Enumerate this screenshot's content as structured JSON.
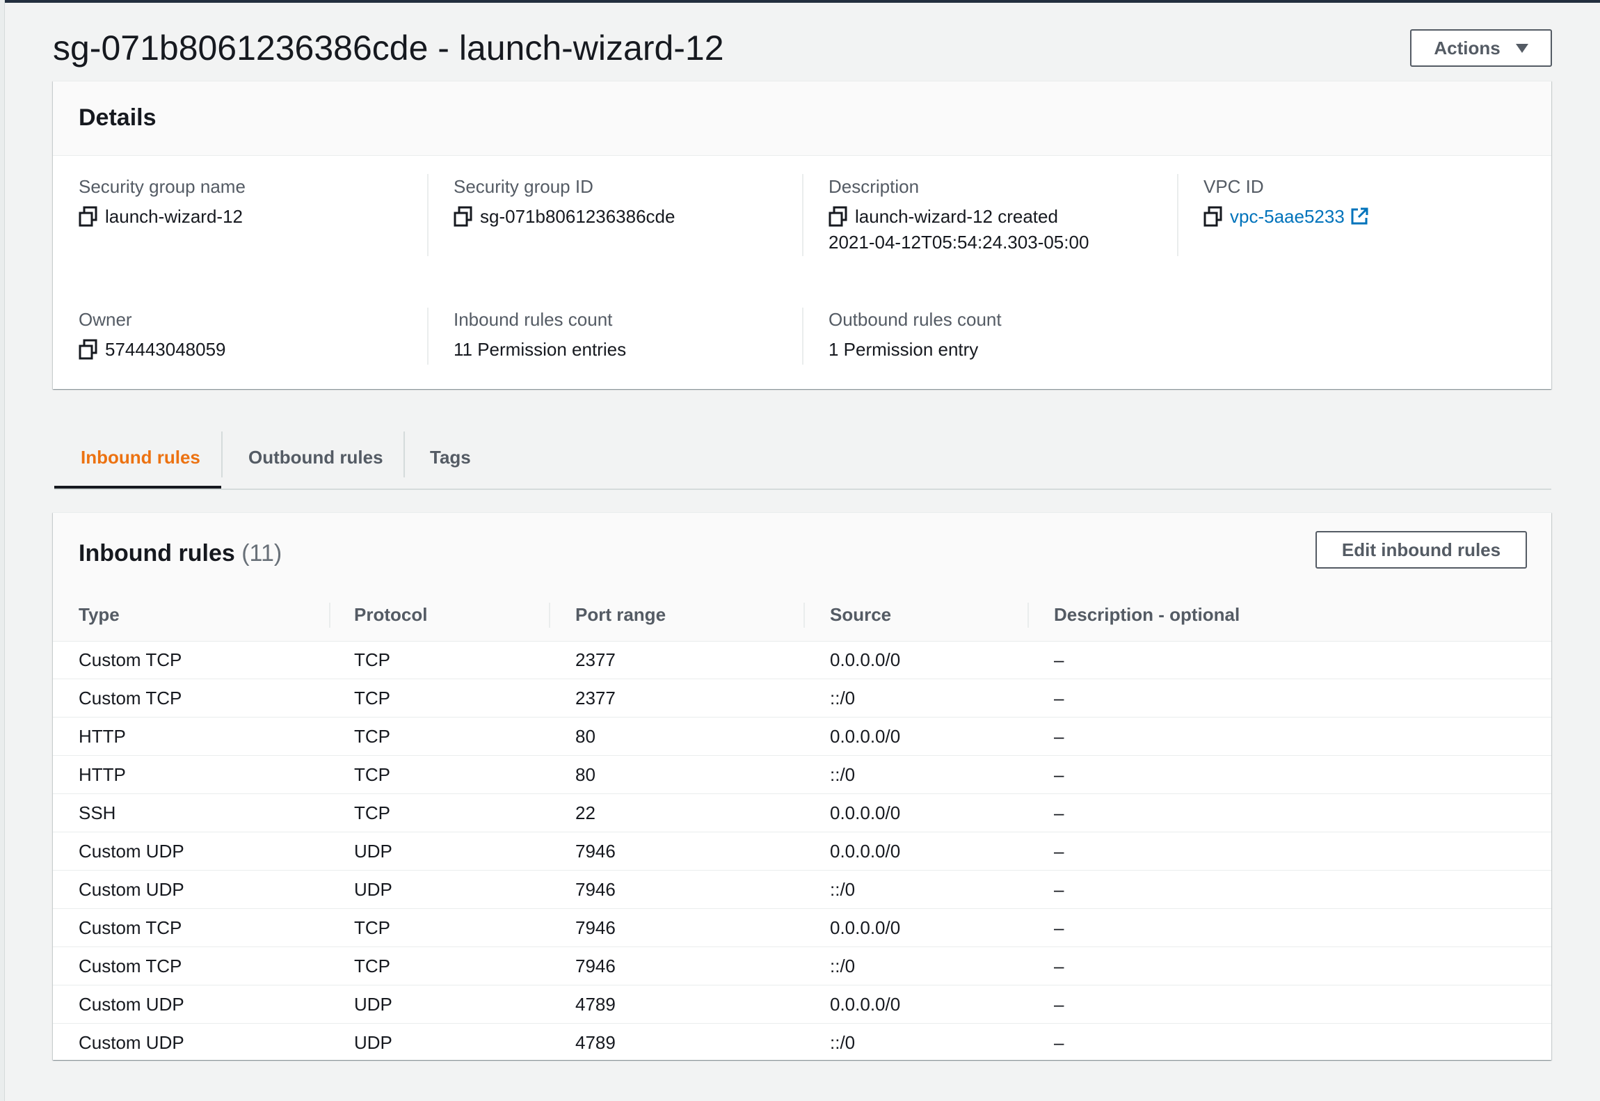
{
  "page": {
    "title": "sg-071b8061236386cde - launch-wizard-12",
    "actions_label": "Actions"
  },
  "details": {
    "heading": "Details",
    "fields": {
      "sg_name": {
        "label": "Security group name",
        "value": "launch-wizard-12"
      },
      "sg_id": {
        "label": "Security group ID",
        "value": "sg-071b8061236386cde"
      },
      "description": {
        "label": "Description",
        "value_line1": "launch-wizard-12 created",
        "value_line2": "2021-04-12T05:54:24.303-05:00"
      },
      "vpc_id": {
        "label": "VPC ID",
        "value": "vpc-5aae5233"
      },
      "owner": {
        "label": "Owner",
        "value": "574443048059"
      },
      "inbound_count": {
        "label": "Inbound rules count",
        "value": "11 Permission entries"
      },
      "outbound_count": {
        "label": "Outbound rules count",
        "value": "1 Permission entry"
      }
    }
  },
  "tabs": [
    {
      "label": "Inbound rules",
      "active": true
    },
    {
      "label": "Outbound rules",
      "active": false
    },
    {
      "label": "Tags",
      "active": false
    }
  ],
  "inbound": {
    "heading": "Inbound rules",
    "count": "(11)",
    "edit_label": "Edit inbound rules",
    "columns": [
      "Type",
      "Protocol",
      "Port range",
      "Source",
      "Description - optional"
    ],
    "rows": [
      [
        "Custom TCP",
        "TCP",
        "2377",
        "0.0.0.0/0",
        "–"
      ],
      [
        "Custom TCP",
        "TCP",
        "2377",
        "::/0",
        "–"
      ],
      [
        "HTTP",
        "TCP",
        "80",
        "0.0.0.0/0",
        "–"
      ],
      [
        "HTTP",
        "TCP",
        "80",
        "::/0",
        "–"
      ],
      [
        "SSH",
        "TCP",
        "22",
        "0.0.0.0/0",
        "–"
      ],
      [
        "Custom UDP",
        "UDP",
        "7946",
        "0.0.0.0/0",
        "–"
      ],
      [
        "Custom UDP",
        "UDP",
        "7946",
        "::/0",
        "–"
      ],
      [
        "Custom TCP",
        "TCP",
        "7946",
        "0.0.0.0/0",
        "–"
      ],
      [
        "Custom TCP",
        "TCP",
        "7946",
        "::/0",
        "–"
      ],
      [
        "Custom UDP",
        "UDP",
        "4789",
        "0.0.0.0/0",
        "–"
      ],
      [
        "Custom UDP",
        "UDP",
        "4789",
        "::/0",
        "–"
      ]
    ]
  },
  "colors": {
    "accent": "#ec7211",
    "link": "#0073bb",
    "text": "#16191f",
    "muted": "#545b64"
  },
  "icons": {
    "copy": "copy-icon",
    "external": "external-link-icon",
    "caret": "caret-down-icon"
  }
}
